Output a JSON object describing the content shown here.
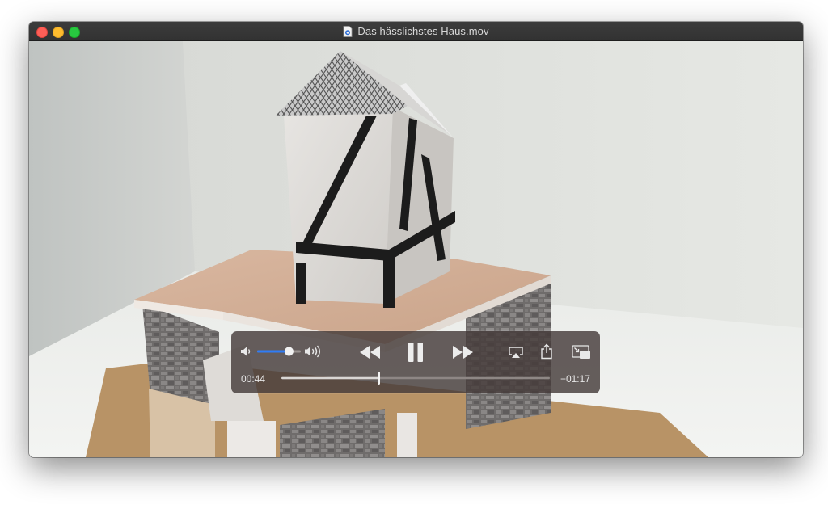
{
  "window": {
    "title": "Das hässlichstes Haus.mov",
    "title_icon": "quicktime-document-icon"
  },
  "player": {
    "current_time": "00:44",
    "remaining_time": "−01:17",
    "progress": 0.363,
    "volume": 0.73,
    "state": "playing"
  },
  "colors": {
    "accent": "#2f7cf6",
    "controls_bg": "#463c3a",
    "close": "#fe5f57",
    "minimize": "#febc2e",
    "zoom": "#28c840"
  },
  "icons": {
    "volume_low": "speaker-low-icon",
    "volume_high": "speaker-high-icon",
    "rewind": "rewind-icon",
    "pause": "pause-icon",
    "fast_forward": "fast-forward-icon",
    "airplay": "airplay-icon",
    "share": "share-icon",
    "pip": "picture-in-picture-icon"
  }
}
